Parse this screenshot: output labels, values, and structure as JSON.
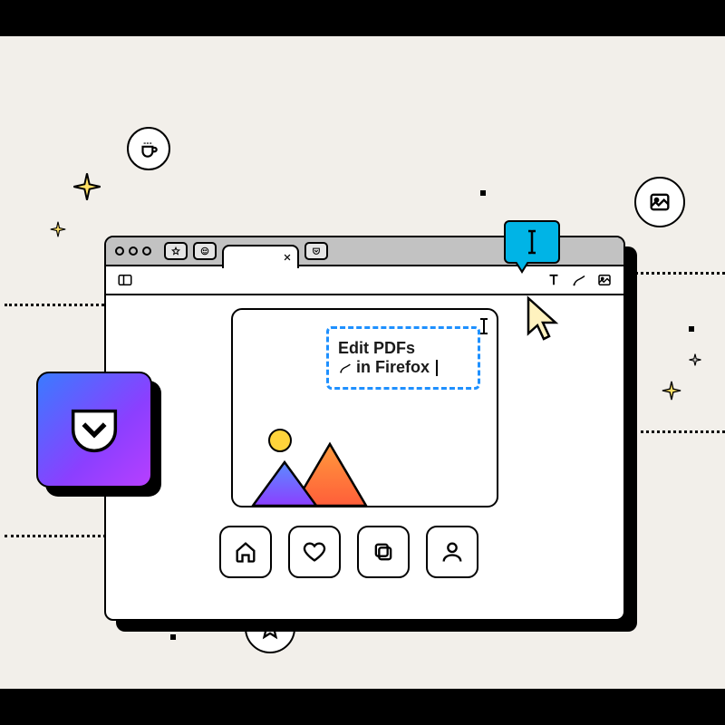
{
  "edit_box": {
    "line1": "Edit PDFs",
    "line2": "in Firefox"
  },
  "tooltip_icon": "text-cursor",
  "nav_buttons": [
    "home",
    "favorite",
    "copy",
    "profile"
  ],
  "toolbar_tools": [
    "text",
    "draw",
    "image"
  ],
  "colors": {
    "tooltip_bg": "#00b4e6",
    "pocket_gradient_start": "#3a7bff",
    "pocket_gradient_end": "#b73fff",
    "edit_border": "#1e90ff"
  }
}
